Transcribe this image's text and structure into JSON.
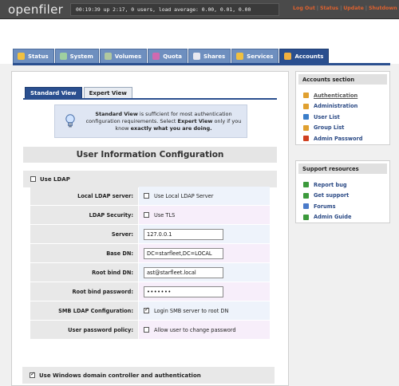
{
  "header": {
    "logo": "openfiler",
    "status_line": "00:19:39 up 2:17, 0 users, load average: 0.00, 0.01, 0.00",
    "links": [
      "Log Out",
      "Status",
      "Update",
      "Shutdown"
    ]
  },
  "tabs": [
    {
      "label": "Status",
      "icon": "status-icon",
      "color": "#f0c040"
    },
    {
      "label": "System",
      "icon": "system-icon",
      "color": "#9fd0a0"
    },
    {
      "label": "Volumes",
      "icon": "volumes-icon",
      "color": "#b0c8a0"
    },
    {
      "label": "Quota",
      "icon": "quota-icon",
      "color": "#d06ab0"
    },
    {
      "label": "Shares",
      "icon": "shares-icon",
      "color": "#e8e8f0"
    },
    {
      "label": "Services",
      "icon": "services-icon",
      "color": "#f0c040"
    },
    {
      "label": "Accounts",
      "icon": "accounts-icon",
      "color": "#f0b040",
      "active": true
    }
  ],
  "view_tabs": {
    "standard": "Standard View",
    "expert": "Expert View"
  },
  "info": {
    "p1": "Standard View",
    "p2": " is sufficient for most authentication configuration requirements. Select ",
    "p3": "Expert View",
    "p4": " only if you know ",
    "p5": "exactly what you are doing."
  },
  "section_title": "User Information Configuration",
  "use_ldap": {
    "label": "Use LDAP",
    "checked": false
  },
  "ldap_form": {
    "server_label": "Local LDAP server:",
    "server_option": "Use Local LDAP Server",
    "security_label": "LDAP Security:",
    "security_option": "Use TLS",
    "host_label": "Server:",
    "host_value": "127.0.0.1",
    "basedn_label": "Base DN:",
    "basedn_value": "DC=starfleet,DC=LOCAL",
    "binddn_label": "Root bind DN:",
    "binddn_value": "ast@starfleet.local",
    "bindpw_label": "Root bind password:",
    "bindpw_value": "•••••••",
    "smb_label": "SMB LDAP Configuration:",
    "smb_option": "Login SMB server to root DN",
    "policy_label": "User password policy:",
    "policy_option": "Allow user to change password"
  },
  "use_windows": {
    "label": "Use Windows domain controller and authentication",
    "checked": true
  },
  "accounts_section": {
    "title": "Accounts section",
    "items": [
      {
        "label": "Authentication",
        "icon": "key-icon",
        "color": "#e0a030"
      },
      {
        "label": "Administration",
        "icon": "admin-icon",
        "color": "#e0a030"
      },
      {
        "label": "User List",
        "icon": "user-icon",
        "color": "#3a7dc9"
      },
      {
        "label": "Group List",
        "icon": "group-icon",
        "color": "#e0a030"
      },
      {
        "label": "Admin Password",
        "icon": "password-icon",
        "color": "#d04020"
      }
    ]
  },
  "support_section": {
    "title": "Support resources",
    "items": [
      {
        "label": "Report bug",
        "icon": "bug-icon",
        "color": "#3c9a3c"
      },
      {
        "label": "Get support",
        "icon": "support-icon",
        "color": "#3c9a3c"
      },
      {
        "label": "Forums",
        "icon": "forums-icon",
        "color": "#4a7ac9"
      },
      {
        "label": "Admin Guide",
        "icon": "guide-icon",
        "color": "#3c9a3c"
      }
    ]
  }
}
